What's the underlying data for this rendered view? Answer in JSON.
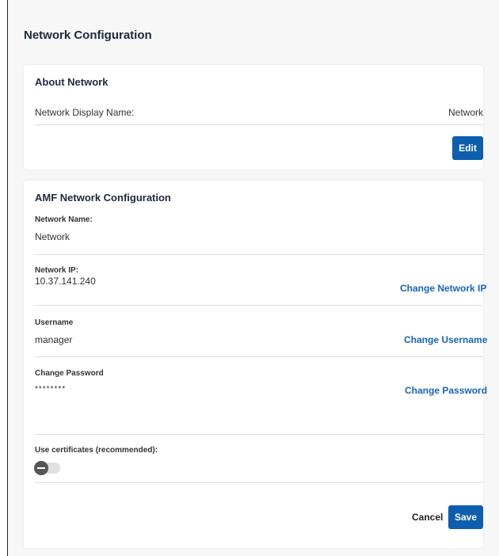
{
  "page": {
    "title": "Network Configuration"
  },
  "about": {
    "title": "About Network",
    "display_name_label": "Network Display Name:",
    "display_name_value": "Network",
    "edit_label": "Edit"
  },
  "amf": {
    "title": "AMF Network Configuration",
    "network_name_label": "Network Name:",
    "network_name_value": "Network",
    "network_ip_label": "Network IP:",
    "network_ip_value": "10.37.141.240",
    "change_network_ip": "Change Network IP",
    "username_label": "Username",
    "username_value": "manager",
    "change_username": "Change Username",
    "password_label": "Change Password",
    "password_value": "********",
    "change_password": "Change Password",
    "certificates_label": "Use certificates (recommended):",
    "certificates_enabled": false,
    "cancel_label": "Cancel",
    "save_label": "Save"
  },
  "colors": {
    "primary": "#0d5fae",
    "link": "#1565c0",
    "background": "#f7f7f7",
    "card": "#ffffff"
  }
}
